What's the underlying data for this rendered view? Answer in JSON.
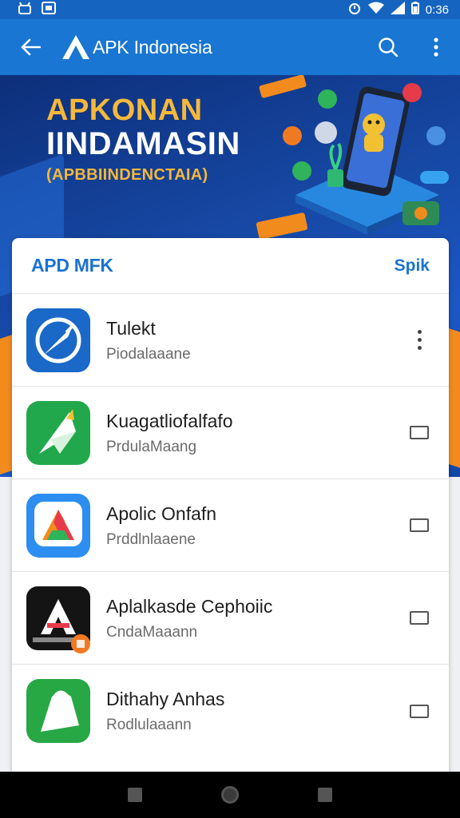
{
  "status_bar": {
    "time": "0:36",
    "icons": [
      "android-icon",
      "image-icon",
      "alarm-icon",
      "wifi-icon",
      "signal-icon",
      "battery-icon"
    ]
  },
  "app_bar": {
    "title": "APK Indonesia",
    "logo_letter": "A",
    "back_icon": "arrow-left-icon",
    "search_icon": "search-icon",
    "menu_icon": "more-vert-icon"
  },
  "hero": {
    "line1": "APKONAN",
    "line2": "IINDAMASIN",
    "line3": "(APBBIINDENCTAIA)"
  },
  "card": {
    "title": "APD MFK",
    "action_label": "Spik",
    "apps": [
      {
        "name": "Tulekt",
        "subtitle": "Piodalaaane",
        "action": "more",
        "icon_color": "#1565c0"
      },
      {
        "name": "Kuagatliofalfafo",
        "subtitle": "PrdulaMaang",
        "action": "checkbox",
        "icon_color": "#21a34a"
      },
      {
        "name": "Apolic Onfafn",
        "subtitle": "Prddlnlaaene",
        "action": "checkbox",
        "icon_color": "#2c8ef0"
      },
      {
        "name": "Aplalkasde Cephoiic",
        "subtitle": "CndaMaaann",
        "action": "checkbox",
        "icon_color": "#111111"
      },
      {
        "name": "Dithahy Anhas",
        "subtitle": "Rodlulaaann",
        "action": "checkbox",
        "icon_color": "#28a745"
      }
    ]
  },
  "colors": {
    "primary": "#1976d2",
    "status_bar": "#1565c0",
    "accent_orange": "#f28b1e",
    "hero_gold": "#f6b83a"
  },
  "nav_bar": {
    "icons": [
      "recent-apps-icon",
      "home-icon",
      "back-square-icon"
    ]
  }
}
